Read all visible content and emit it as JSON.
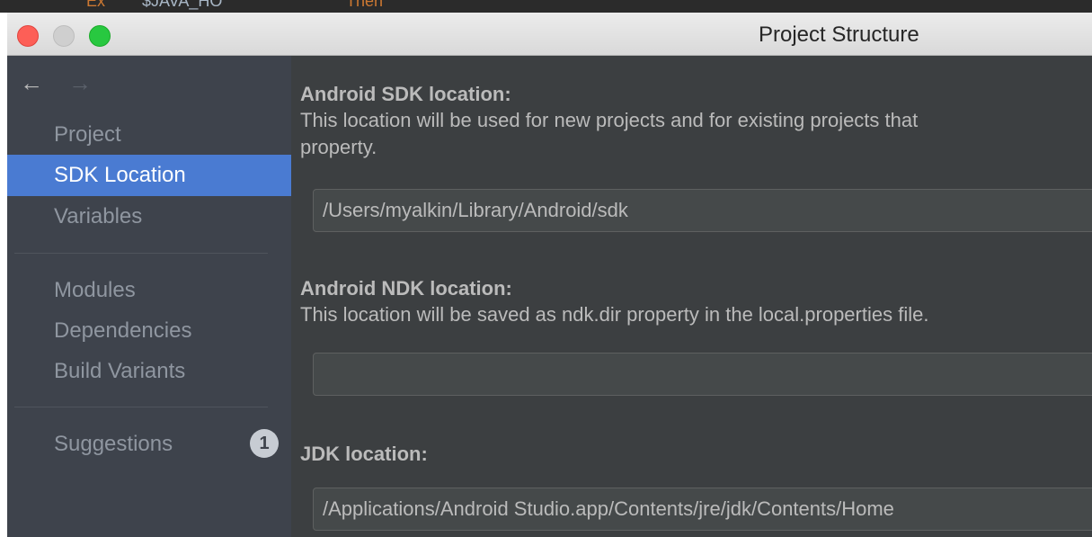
{
  "window": {
    "title": "Project Structure",
    "background_text": [
      "Ex",
      "$JAVA_HO",
      "Then"
    ]
  },
  "nav": {
    "back_glyph": "←",
    "forward_glyph": "→"
  },
  "sidebar": {
    "items": [
      {
        "label": "Project",
        "selected": false
      },
      {
        "label": "SDK Location",
        "selected": true
      },
      {
        "label": "Variables",
        "selected": false
      },
      {
        "label": "Modules",
        "selected": false
      },
      {
        "label": "Dependencies",
        "selected": false
      },
      {
        "label": "Build Variants",
        "selected": false
      },
      {
        "label": "Suggestions",
        "selected": false,
        "badge": "1"
      }
    ]
  },
  "content": {
    "sdk": {
      "heading": "Android SDK location:",
      "desc_line1": "This location will be used for new projects and for existing projects that",
      "desc_line2": "property.",
      "value": "/Users/myalkin/Library/Android/sdk"
    },
    "ndk": {
      "heading": "Android NDK location:",
      "desc": "This location will be saved as ndk.dir property in the local.properties file.",
      "value": ""
    },
    "jdk": {
      "heading": "JDK location:",
      "value": "/Applications/Android Studio.app/Contents/jre/jdk/Contents/Home"
    }
  },
  "colors": {
    "accent_selected": "#4a7bd2",
    "sidebar_bg": "#3e434c",
    "content_bg": "#3c3f41",
    "close": "#fd5f57",
    "maximize": "#28c840"
  }
}
